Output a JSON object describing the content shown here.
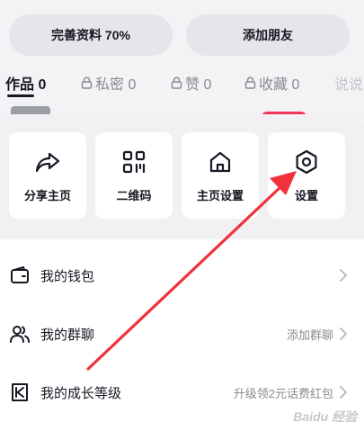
{
  "profile": {
    "complete_label": "完善资料 70%",
    "add_friend_label": "添加朋友"
  },
  "tabs": [
    {
      "label": "作品 0"
    },
    {
      "label": "私密 0"
    },
    {
      "label": "赞 0"
    },
    {
      "label": "收藏 0"
    },
    {
      "label": "说说"
    }
  ],
  "grid": [
    {
      "label": "分享主页",
      "icon": "share-icon"
    },
    {
      "label": "二维码",
      "icon": "qr-code-icon"
    },
    {
      "label": "主页设置",
      "icon": "home-icon"
    },
    {
      "label": "设置",
      "icon": "gear-icon"
    }
  ],
  "list": [
    {
      "label": "我的钱包",
      "value": "",
      "icon": "wallet-icon"
    },
    {
      "label": "我的群聊",
      "value": "添加群聊",
      "icon": "group-icon"
    },
    {
      "label": "我的成长等级",
      "value": "升级领2元话费红包",
      "icon": "level-icon"
    }
  ],
  "watermark": "Baidu 经验",
  "colors": {
    "arrow": "#f0323c",
    "accent": "#f2365a"
  }
}
